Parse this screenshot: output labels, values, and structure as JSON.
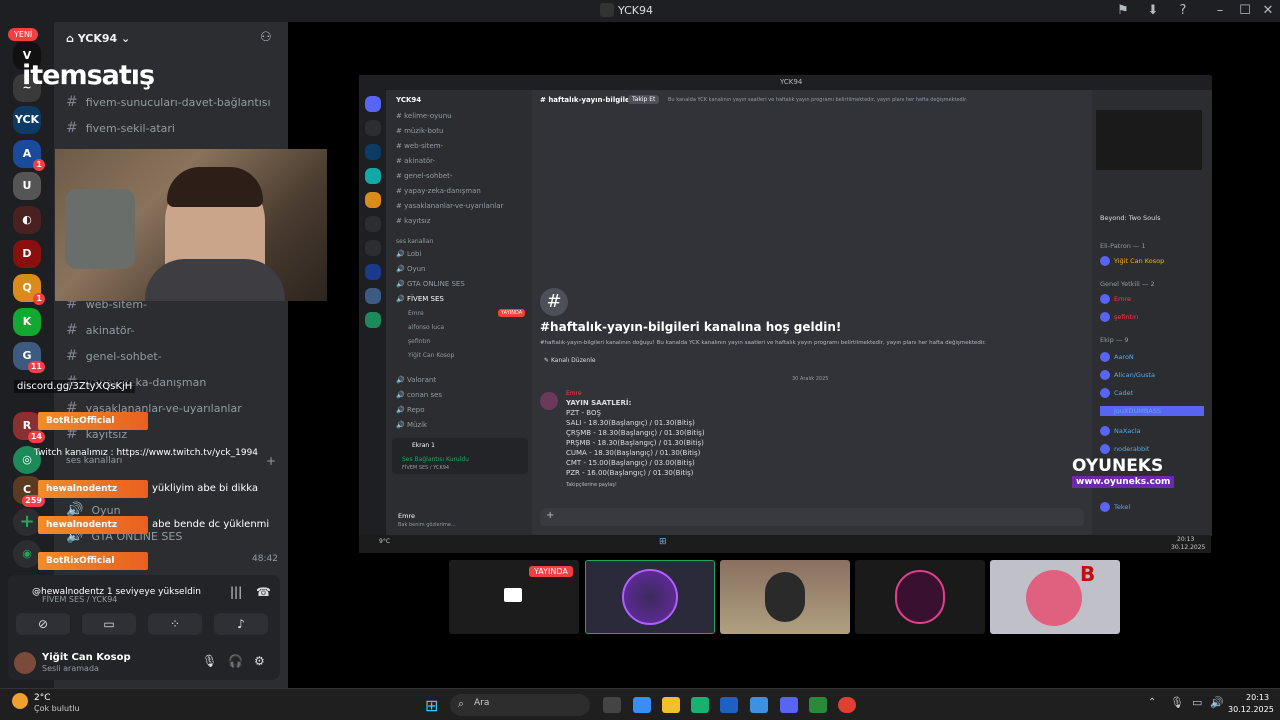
{
  "window": {
    "title": "YCK94"
  },
  "server_badge_new": "YENİ",
  "server_badges": [
    "1",
    "1",
    "11",
    "14",
    "259"
  ],
  "left_panel": {
    "server_name": "YCK94",
    "channels": [
      "fivem-sunucuları-davet-bağlantısı",
      "fivem-sekil-atari",
      "web-sitem-",
      "akinatör-",
      "genel-sohbet-",
      "yapay-zeka-danışman",
      "yasaklananlar-ve-uyarılanlar",
      "kayıtsız"
    ],
    "voice_category": "ses kanalları",
    "voice_channels": [
      "Oyun",
      "GTA ONLINE SES"
    ],
    "voice_status": "Ses Bağlantısı Kuruldu",
    "voice_sub": "FİVEM SES / YCK94",
    "time": "48:42",
    "user": {
      "name": "Yiğit Can Kosop",
      "status": "Sesli aramada"
    }
  },
  "watermark": "itemsatış",
  "overlay_text": {
    "discord": "discord.gg/3ZtyXQsKjH",
    "twitch": "Twitch kanalımız : https://www.twitch.tv/yck_1994",
    "levelup": "@hewalnodentz 1 seviyeye yükseldin"
  },
  "chat": [
    {
      "nick": "BotRixOfficial",
      "text": ""
    },
    {
      "nick": "hewalnodentz",
      "text": "yükliyim abe bi dikka"
    },
    {
      "nick": "hewalnodentz",
      "text": "abe bende dc yüklenmi"
    },
    {
      "nick": "BotRixOfficial",
      "text": ""
    }
  ],
  "share": {
    "title": "YCK94",
    "server": "YCK94",
    "channels": [
      "kelime-oyunu",
      "müzik-botu",
      "web-sitem-",
      "akinatör-",
      "genel-sohbet-",
      "yapay-zeka-danışman",
      "yasaklananlar-ve-uyarılanlar",
      "kayıtsız"
    ],
    "voice_category": "ses kanalları",
    "voice_channels": [
      "Lobi",
      "Oyun",
      "GTA ONLINE SES",
      "FİVEM SES"
    ],
    "voice_users": [
      "Emre",
      "alfonso luca",
      "şefintırı",
      "Yiğit Can Kosop"
    ],
    "live": "YAYINDA",
    "more_channels": [
      "Valorant",
      "conan ses",
      "Repo",
      "Müzik"
    ],
    "screen_label": "Ekran 1",
    "voice_status": "Ses Bağlantısı Kuruldu",
    "voice_sub": "FİVEM SES / YCK94",
    "user": "Emre",
    "user_status": "Bak benim gözlerime...",
    "channel_header": "haftalık-yayın-bilgileri",
    "follow": "Takip Et",
    "topic": "Bu kanalda YCK kanalının yayın saatleri ve haftalık yayın programı belirtilmektedir, yayın planı her hafta değişmektedir.",
    "search": "YCK94 sunucusunu ara",
    "welcome": "#haftalık-yayın-bilgileri kanalına hoş geldin!",
    "welcome_sub": "#haftalık-yayın-bilgileri kanalının doğuşu! Bu kanalda YCK kanalının yayın saatleri ve haftalık yayın programı belirtilmektedir, yayın planı her hafta değişmektedir.",
    "edit_channel": "Kanalı Düzenle",
    "date": "30 Aralık 2025",
    "msg_author": "Emre",
    "msg_title": "YAYIN SAATLERİ:",
    "msg_lines": [
      "PZT - BOŞ",
      "SALI - 18.30(Başlangıç) / 01.30(Bitiş)",
      "ÇRŞMB - 18.30(Başlangıç) / 01.30(Bitiş)",
      "PRŞMB - 18.30(Başlangıç) / 01.30(Bitiş)",
      "CUMA - 18.30(Başlangıç) / 01.30(Bitiş)",
      "CMT - 15.00(Başlangıç) / 03.00(Bitiş)",
      "PZR - 16.00(Başlangıç) / 01.30(Bitiş)"
    ],
    "followers_note": "Takipçilerine paylaş!",
    "members": [
      "Beyond: Two Souls",
      "Eli-Patron — 1",
      "Yiğit Can Kosop",
      "Genel Yetkili — 2",
      "Emre",
      "şefintırı",
      "Ekip — 9",
      "AaroN",
      "Alican/Gusta",
      "Cadet",
      "JouXDUMBASS",
      "NaXacla",
      "noderabbit",
      "Tekel"
    ]
  },
  "taskbar2": {
    "weather": "9°C",
    "time": "20:13",
    "date": "30.12.2025"
  },
  "tiles": {
    "live": "YAYINDA"
  },
  "oyuneks": {
    "brand": "OYUNEKS",
    "url": "www.oyuneks.com"
  },
  "taskbar": {
    "weather_temp": "2°C",
    "weather_desc": "Çok bulutlu",
    "search": "Ara",
    "time": "20:13",
    "date": "30.12.2025"
  }
}
